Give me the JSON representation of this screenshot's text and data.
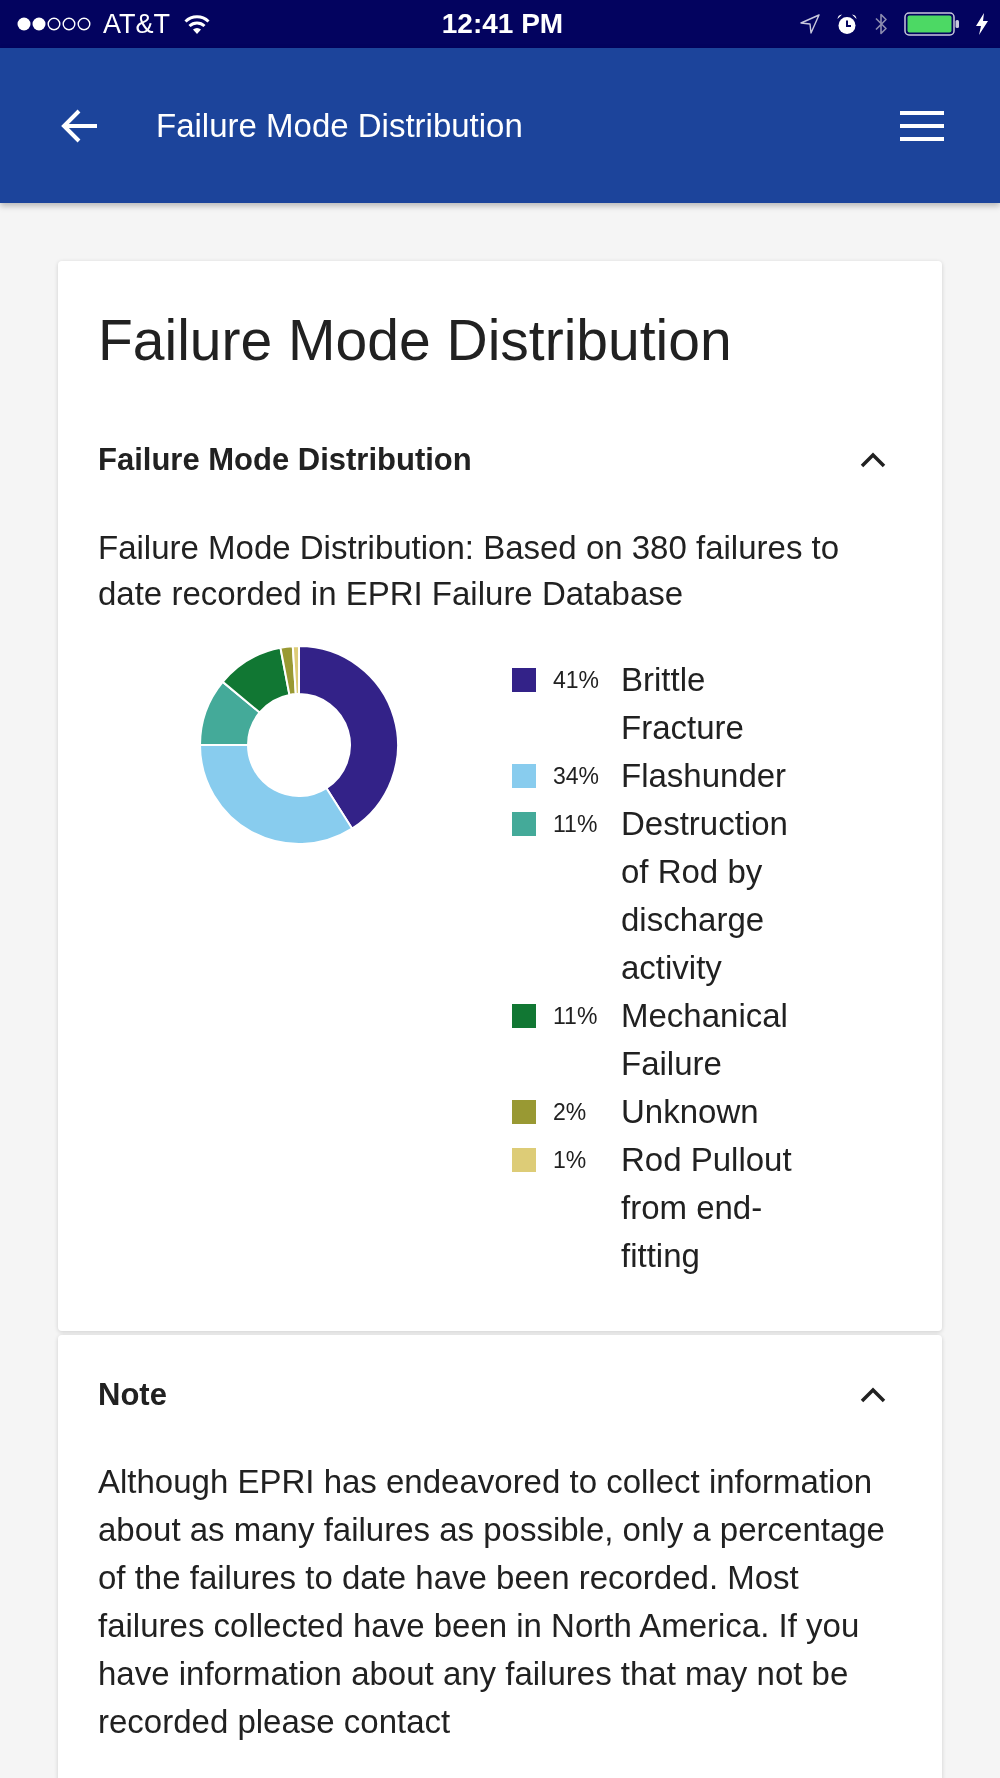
{
  "status_bar": {
    "carrier": "AT&T",
    "time": "12:41 PM"
  },
  "app_bar": {
    "title": "Failure Mode Distribution"
  },
  "page_title": "Failure Mode Distribution",
  "sections": [
    {
      "title": "Failure Mode Distribution",
      "expanded": true,
      "description": "Failure Mode Distribution: Based on 380 failures to date recorded in EPRI Failure Database",
      "chart_data": {
        "type": "donut",
        "categories": [
          "Brittle Fracture",
          "Flashunder",
          "Destruction of Rod by discharge activity",
          "Mechanical Failure",
          "Unknown",
          "Rod Pullout from end-fitting"
        ],
        "values": [
          41,
          34,
          11,
          11,
          2,
          1
        ],
        "value_labels": [
          "41%",
          "34%",
          "11%",
          "11%",
          "2%",
          "1%"
        ],
        "colors": [
          "#332288",
          "#88ccee",
          "#44aa99",
          "#117733",
          "#999933",
          "#ddcc77"
        ]
      }
    },
    {
      "title": "Note",
      "expanded": true,
      "text": "Although EPRI has endeavored to collect information about as many failures as possible, only a percentage of the failures to date have been recorded. Most failures collected have been in North America. If you have information about any failures that may not be recorded please contact"
    }
  ]
}
